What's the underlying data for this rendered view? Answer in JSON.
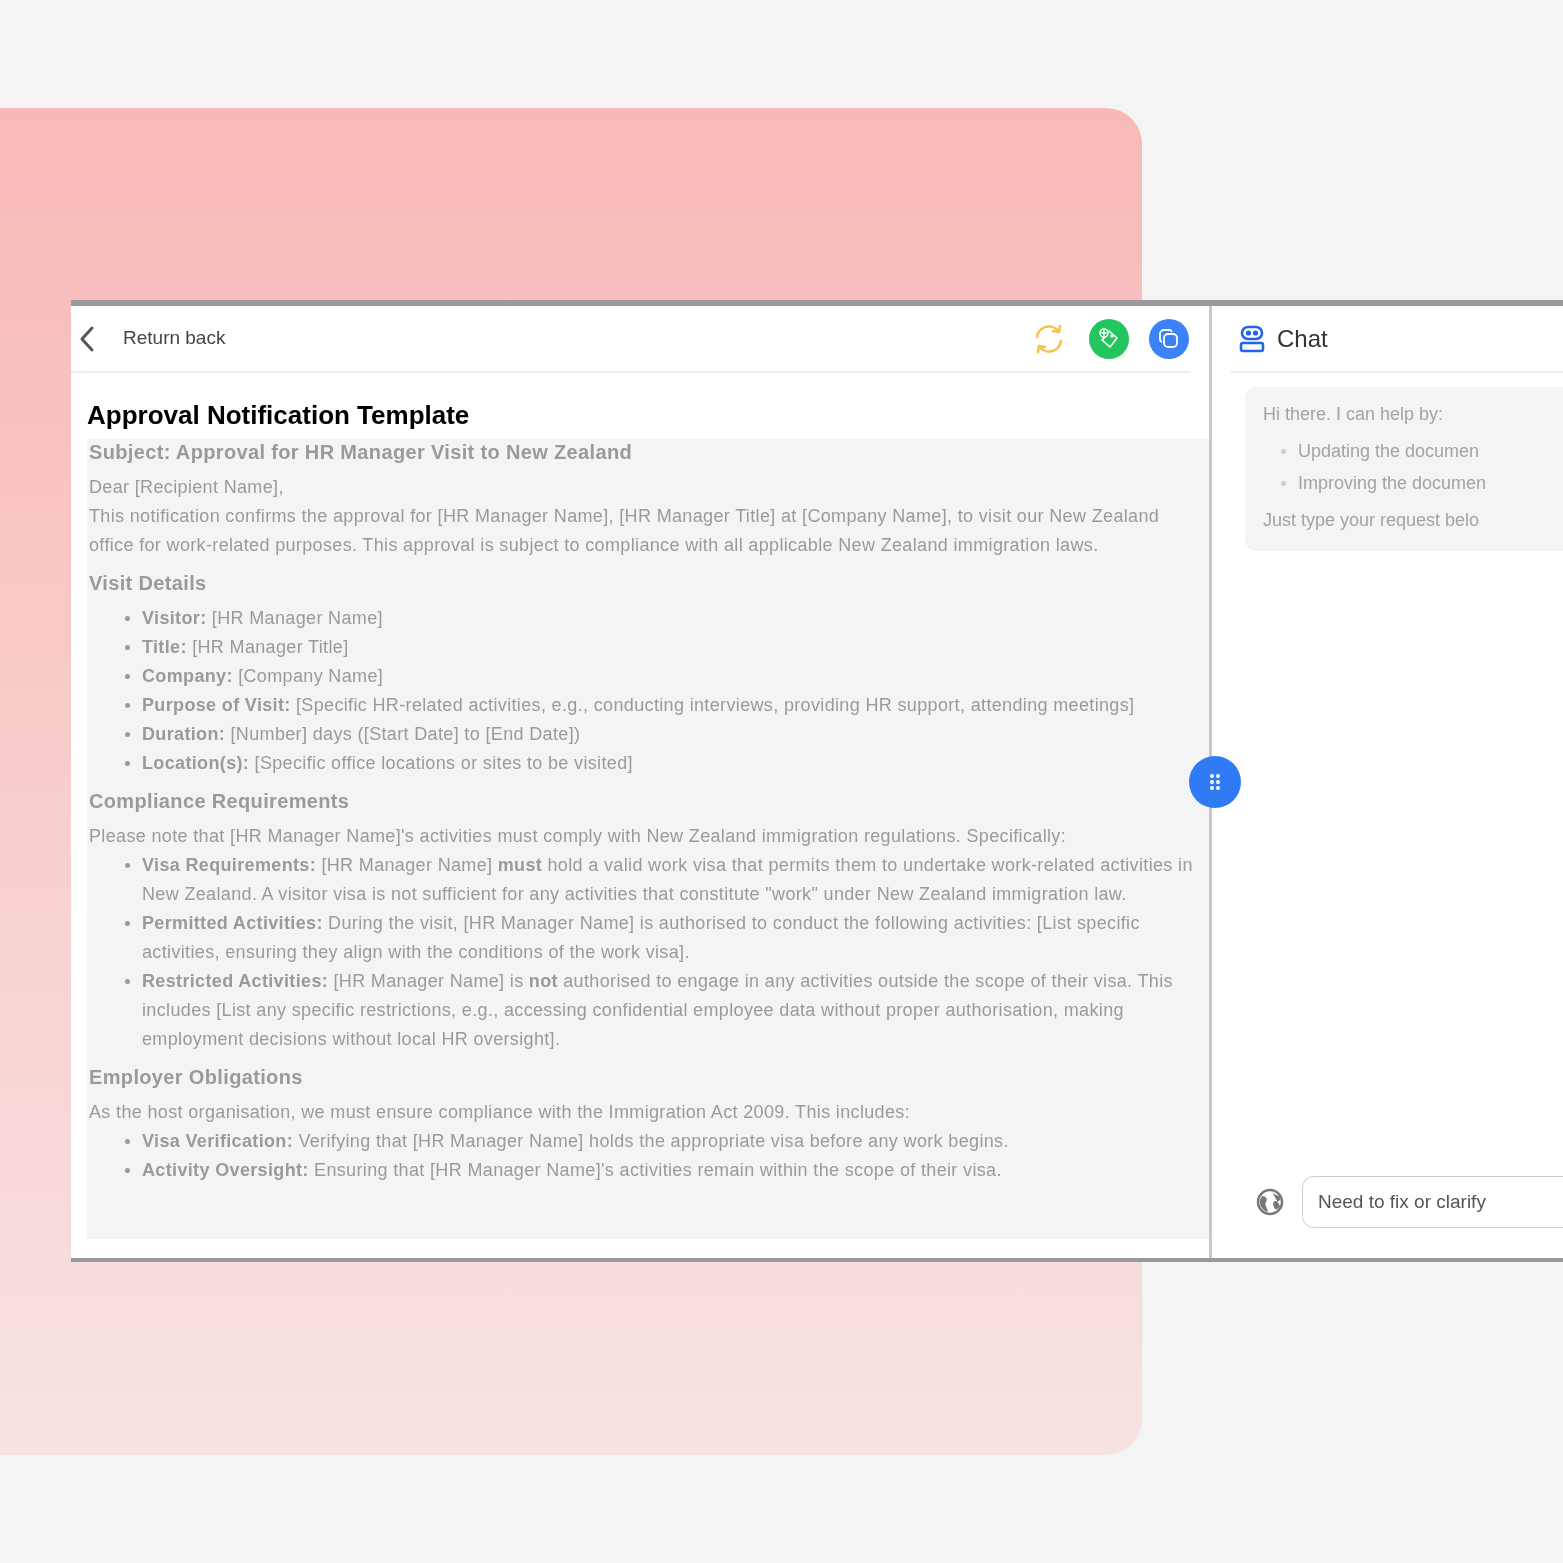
{
  "toolbar": {
    "back_label": "Return back"
  },
  "document": {
    "title": "Approval Notification Template",
    "blocks": [
      {
        "kind": "subject",
        "text": "Subject: Approval for HR Manager Visit to New Zealand"
      },
      {
        "kind": "paragraph",
        "text": "Dear [Recipient Name],"
      },
      {
        "kind": "paragraph",
        "text": "This notification confirms the approval for [HR Manager Name], [HR Manager Title] at [Company Name], to visit our New Zealand office for work-related purposes. This approval is subject to compliance with all applicable New Zealand immigration laws."
      },
      {
        "kind": "heading",
        "text": "Visit Details"
      },
      {
        "kind": "bullets",
        "items": [
          "**Visitor:** [HR Manager Name]",
          "**Title:** [HR Manager Title]",
          "**Company:** [Company Name]",
          "**Purpose of Visit:** [Specific HR-related activities, e.g., conducting interviews, providing HR support, attending meetings]",
          "**Duration:** [Number] days ([Start Date] to [End Date])",
          "**Location(s):** [Specific office locations or sites to be visited]"
        ]
      },
      {
        "kind": "heading",
        "text": "Compliance Requirements"
      },
      {
        "kind": "paragraph",
        "text": "Please note that [HR Manager Name]'s activities must comply with New Zealand immigration regulations. Specifically:"
      },
      {
        "kind": "bullets",
        "items": [
          "**Visa Requirements:** [HR Manager Name] **must** hold a valid work visa that permits them to undertake work-related activities in New Zealand. A visitor visa is not sufficient for any activities that constitute \"work\" under New Zealand immigration law.",
          "**Permitted Activities:** During the visit, [HR Manager Name] is authorised to conduct the following activities: [List specific activities, ensuring they align with the conditions of the work visa].",
          "**Restricted Activities:** [HR Manager Name] is **not** authorised to engage in any activities outside the scope of their visa. This includes [List any specific restrictions, e.g., accessing confidential employee data without proper authorisation, making employment decisions without local HR oversight]."
        ]
      },
      {
        "kind": "heading",
        "text": "Employer Obligations"
      },
      {
        "kind": "paragraph",
        "text": "As the host organisation, we must ensure compliance with the Immigration Act 2009. This includes:"
      },
      {
        "kind": "bullets",
        "items": [
          "**Visa Verification:** Verifying that [HR Manager Name] holds the appropriate visa before any work begins.",
          "**Activity Oversight:** Ensuring that [HR Manager Name]'s activities remain within the scope of their visa."
        ]
      }
    ]
  },
  "chat": {
    "title": "Chat",
    "message": {
      "intro": "Hi there. I can help by:",
      "items": [
        "Updating the documen",
        "Improving the documen"
      ],
      "outro": "Just type your request belo"
    },
    "input": {
      "placeholder": "Need to fix or clarify"
    }
  }
}
